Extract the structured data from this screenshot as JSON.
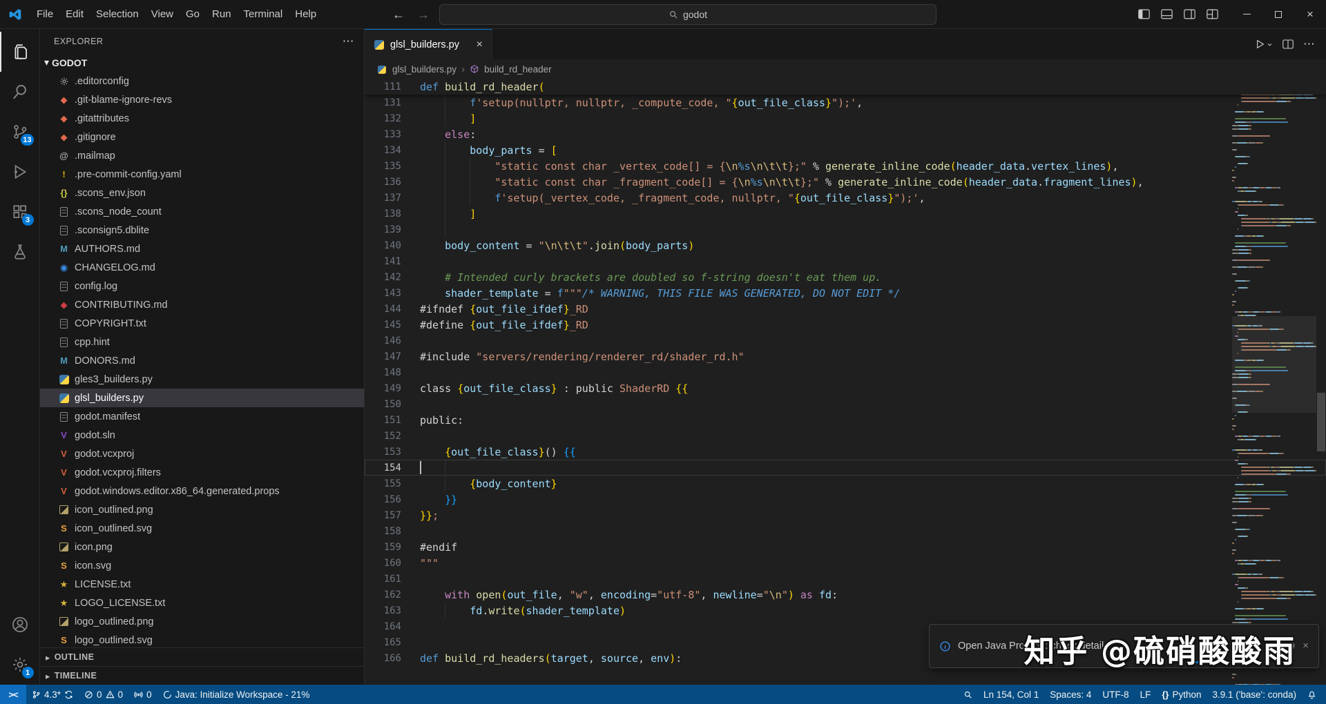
{
  "titlebar": {
    "menus": [
      "File",
      "Edit",
      "Selection",
      "View",
      "Go",
      "Run",
      "Terminal",
      "Help"
    ],
    "back_arrow": "←",
    "forward_arrow": "→",
    "search_value": "godot"
  },
  "activitybar": {
    "items": [
      {
        "name": "explorer",
        "active": true,
        "badge": ""
      },
      {
        "name": "search",
        "active": false,
        "badge": ""
      },
      {
        "name": "source-control",
        "active": false,
        "badge": "13"
      },
      {
        "name": "run-debug",
        "active": false,
        "badge": ""
      },
      {
        "name": "extensions",
        "active": false,
        "badge": "3"
      },
      {
        "name": "testing",
        "active": false,
        "badge": ""
      }
    ],
    "bottom_items": [
      {
        "name": "account",
        "active": false,
        "badge": ""
      },
      {
        "name": "settings",
        "active": false,
        "badge": "1"
      }
    ]
  },
  "sidebar": {
    "title": "EXPLORER",
    "dots": "⋯",
    "section": "GODOT",
    "section_chevron": "▾",
    "outline_label": "OUTLINE",
    "timeline_label": "TIMELINE",
    "panel_chevron": "▸",
    "files": [
      {
        "name": ".editorconfig",
        "icon": "gear",
        "selected": false
      },
      {
        "name": ".git-blame-ignore-revs",
        "icon": "git",
        "selected": false
      },
      {
        "name": ".gitattributes",
        "icon": "git",
        "selected": false
      },
      {
        "name": ".gitignore",
        "icon": "git",
        "selected": false
      },
      {
        "name": ".mailmap",
        "icon": "mail",
        "selected": false
      },
      {
        "name": ".pre-commit-config.yaml",
        "icon": "yaml",
        "selected": false
      },
      {
        "name": ".scons_env.json",
        "icon": "json",
        "selected": false
      },
      {
        "name": ".scons_node_count",
        "icon": "doc",
        "selected": false
      },
      {
        "name": ".sconsign5.dblite",
        "icon": "doc",
        "selected": false
      },
      {
        "name": "AUTHORS.md",
        "icon": "md",
        "selected": false
      },
      {
        "name": "CHANGELOG.md",
        "icon": "changelog",
        "selected": false
      },
      {
        "name": "config.log",
        "icon": "doc",
        "selected": false
      },
      {
        "name": "CONTRIBUTING.md",
        "icon": "contrib",
        "selected": false
      },
      {
        "name": "COPYRIGHT.txt",
        "icon": "doc",
        "selected": false
      },
      {
        "name": "cpp.hint",
        "icon": "doc",
        "selected": false
      },
      {
        "name": "DONORS.md",
        "icon": "md",
        "selected": false
      },
      {
        "name": "gles3_builders.py",
        "icon": "python",
        "selected": false
      },
      {
        "name": "glsl_builders.py",
        "icon": "python",
        "selected": true
      },
      {
        "name": "godot.manifest",
        "icon": "doc",
        "selected": false
      },
      {
        "name": "godot.sln",
        "icon": "sln",
        "selected": false
      },
      {
        "name": "godot.vcxproj",
        "icon": "vs",
        "selected": false
      },
      {
        "name": "godot.vcxproj.filters",
        "icon": "vs",
        "selected": false
      },
      {
        "name": "godot.windows.editor.x86_64.generated.props",
        "icon": "vs",
        "selected": false
      },
      {
        "name": "icon_outlined.png",
        "icon": "image",
        "selected": false
      },
      {
        "name": "icon_outlined.svg",
        "icon": "svgfile",
        "selected": false
      },
      {
        "name": "icon.png",
        "icon": "image",
        "selected": false
      },
      {
        "name": "icon.svg",
        "icon": "svgfile",
        "selected": false
      },
      {
        "name": "LICENSE.txt",
        "icon": "cert",
        "selected": false
      },
      {
        "name": "LOGO_LICENSE.txt",
        "icon": "cert",
        "selected": false
      },
      {
        "name": "logo_outlined.png",
        "icon": "image",
        "selected": false
      },
      {
        "name": "logo_outlined.svg",
        "icon": "svgfile",
        "selected": false
      }
    ]
  },
  "editor": {
    "tab": {
      "label": "glsl_builders.py",
      "close": "×"
    },
    "breadcrumbs": [
      "glsl_builders.py",
      "build_rd_header"
    ],
    "breadcrumb_sep": "›",
    "current_line": 154,
    "cursor_col": 1,
    "sticky": {
      "n": "111",
      "t": [
        [
          "k",
          "def "
        ],
        [
          "fn",
          "build_rd_header"
        ],
        [
          "b1",
          "("
        ]
      ]
    },
    "lines": [
      {
        "n": 131,
        "g": 1,
        "t": [
          [
            "ws",
            "        "
          ],
          [
            "k",
            "f"
          ],
          [
            "s",
            "'setup(nullptr, nullptr, _compute_code, \""
          ],
          [
            "b1",
            "{"
          ],
          [
            "v",
            "out_file_class"
          ],
          [
            "b1",
            "}"
          ],
          [
            "s",
            "\");'"
          ],
          [
            "p",
            ","
          ]
        ]
      },
      {
        "n": 132,
        "g": 1,
        "t": [
          [
            "ws",
            "        "
          ],
          [
            "b1",
            "]"
          ]
        ]
      },
      {
        "n": 133,
        "g": 0,
        "t": [
          [
            "ws",
            "    "
          ],
          [
            "kc",
            "else"
          ],
          [
            "p",
            ":"
          ]
        ]
      },
      {
        "n": 134,
        "g": 1,
        "t": [
          [
            "ws",
            "        "
          ],
          [
            "v",
            "body_parts"
          ],
          [
            "p",
            " = "
          ],
          [
            "b1",
            "["
          ]
        ]
      },
      {
        "n": 135,
        "g": 2,
        "t": [
          [
            "ws",
            "            "
          ],
          [
            "s",
            "\"static const char _vertex_code[] = {"
          ],
          [
            "e",
            "\\n"
          ],
          [
            "fs",
            "%s"
          ],
          [
            "e",
            "\\n\\t\\t"
          ],
          [
            "s",
            "};\""
          ],
          [
            "p",
            " % "
          ],
          [
            "fn",
            "generate_inline_code"
          ],
          [
            "b1",
            "("
          ],
          [
            "v",
            "header_data"
          ],
          [
            "p",
            "."
          ],
          [
            "v",
            "vertex_lines"
          ],
          [
            "b1",
            ")"
          ],
          [
            "p",
            ","
          ]
        ]
      },
      {
        "n": 136,
        "g": 2,
        "t": [
          [
            "ws",
            "            "
          ],
          [
            "s",
            "\"static const char _fragment_code[] = {"
          ],
          [
            "e",
            "\\n"
          ],
          [
            "fs",
            "%s"
          ],
          [
            "e",
            "\\n\\t\\t"
          ],
          [
            "s",
            "};\""
          ],
          [
            "p",
            " % "
          ],
          [
            "fn",
            "generate_inline_code"
          ],
          [
            "b1",
            "("
          ],
          [
            "v",
            "header_data"
          ],
          [
            "p",
            "."
          ],
          [
            "v",
            "fragment_lines"
          ],
          [
            "b1",
            ")"
          ],
          [
            "p",
            ","
          ]
        ]
      },
      {
        "n": 137,
        "g": 2,
        "t": [
          [
            "ws",
            "            "
          ],
          [
            "k",
            "f"
          ],
          [
            "s",
            "'setup(_vertex_code, _fragment_code, nullptr, \""
          ],
          [
            "b1",
            "{"
          ],
          [
            "v",
            "out_file_class"
          ],
          [
            "b1",
            "}"
          ],
          [
            "s",
            "\");'"
          ],
          [
            "p",
            ","
          ]
        ]
      },
      {
        "n": 138,
        "g": 1,
        "t": [
          [
            "ws",
            "        "
          ],
          [
            "b1",
            "]"
          ]
        ]
      },
      {
        "n": 139,
        "g": 1,
        "t": []
      },
      {
        "n": 140,
        "g": 0,
        "t": [
          [
            "ws",
            "    "
          ],
          [
            "v",
            "body_content"
          ],
          [
            "p",
            " = "
          ],
          [
            "s",
            "\""
          ],
          [
            "e",
            "\\n\\t\\t"
          ],
          [
            "s",
            "\""
          ],
          [
            "p",
            "."
          ],
          [
            "fn",
            "join"
          ],
          [
            "b1",
            "("
          ],
          [
            "v",
            "body_parts"
          ],
          [
            "b1",
            ")"
          ]
        ]
      },
      {
        "n": 141,
        "g": 0,
        "t": []
      },
      {
        "n": 142,
        "g": 0,
        "t": [
          [
            "ws",
            "    "
          ],
          [
            "c",
            "# Intended curly brackets are doubled so f-string doesn't eat them up."
          ]
        ]
      },
      {
        "n": 143,
        "g": 0,
        "t": [
          [
            "ws",
            "    "
          ],
          [
            "v",
            "shader_template"
          ],
          [
            "p",
            " = "
          ],
          [
            "k",
            "f"
          ],
          [
            "s",
            "\"\"\""
          ],
          [
            "cm",
            "/* WARNING, THIS FILE WAS GENERATED, DO NOT EDIT */"
          ]
        ]
      },
      {
        "n": 144,
        "g": 0,
        "t": [
          [
            "p",
            "#ifndef "
          ],
          [
            "b1",
            "{"
          ],
          [
            "v",
            "out_file_ifdef"
          ],
          [
            "b1",
            "}"
          ],
          [
            "s",
            "_RD"
          ]
        ]
      },
      {
        "n": 145,
        "g": 0,
        "t": [
          [
            "p",
            "#define "
          ],
          [
            "b1",
            "{"
          ],
          [
            "v",
            "out_file_ifdef"
          ],
          [
            "b1",
            "}"
          ],
          [
            "s",
            "_RD"
          ]
        ]
      },
      {
        "n": 146,
        "g": 0,
        "t": []
      },
      {
        "n": 147,
        "g": 0,
        "t": [
          [
            "p",
            "#include "
          ],
          [
            "s",
            "\"servers/rendering/renderer_rd/shader_rd.h\""
          ]
        ]
      },
      {
        "n": 148,
        "g": 0,
        "t": []
      },
      {
        "n": 149,
        "g": 0,
        "t": [
          [
            "p",
            "class "
          ],
          [
            "b1",
            "{"
          ],
          [
            "v",
            "out_file_class"
          ],
          [
            "b1",
            "}"
          ],
          [
            "p",
            " : public "
          ],
          [
            "s",
            "ShaderRD"
          ],
          [
            "p",
            " "
          ],
          [
            "b1",
            "{{"
          ]
        ]
      },
      {
        "n": 150,
        "g": 0,
        "t": []
      },
      {
        "n": 151,
        "g": 0,
        "t": [
          [
            "p",
            "public:"
          ]
        ]
      },
      {
        "n": 152,
        "g": 0,
        "t": []
      },
      {
        "n": 153,
        "g": 0,
        "t": [
          [
            "ws",
            "    "
          ],
          [
            "b1",
            "{"
          ],
          [
            "v",
            "out_file_class"
          ],
          [
            "b1",
            "}"
          ],
          [
            "p",
            "() "
          ],
          [
            "b2",
            "{{"
          ]
        ]
      },
      {
        "n": 154,
        "g": 1,
        "t": []
      },
      {
        "n": 155,
        "g": 1,
        "t": [
          [
            "ws",
            "        "
          ],
          [
            "b1",
            "{"
          ],
          [
            "v",
            "body_content"
          ],
          [
            "b1",
            "}"
          ]
        ]
      },
      {
        "n": 156,
        "g": 0,
        "t": [
          [
            "ws",
            "    "
          ],
          [
            "b2",
            "}}"
          ]
        ]
      },
      {
        "n": 157,
        "g": 0,
        "t": [
          [
            "b1",
            "}}"
          ],
          [
            "s",
            ";"
          ]
        ]
      },
      {
        "n": 158,
        "g": 0,
        "t": []
      },
      {
        "n": 159,
        "g": 0,
        "t": [
          [
            "p",
            "#endif"
          ]
        ]
      },
      {
        "n": 160,
        "g": 0,
        "t": [
          [
            "s",
            "\"\"\""
          ]
        ]
      },
      {
        "n": 161,
        "g": 0,
        "t": []
      },
      {
        "n": 162,
        "g": 0,
        "t": [
          [
            "ws",
            "    "
          ],
          [
            "kc",
            "with"
          ],
          [
            "p",
            " "
          ],
          [
            "fn",
            "open"
          ],
          [
            "b1",
            "("
          ],
          [
            "v",
            "out_file"
          ],
          [
            "p",
            ", "
          ],
          [
            "s",
            "\"w\""
          ],
          [
            "p",
            ", "
          ],
          [
            "v",
            "encoding"
          ],
          [
            "p",
            "="
          ],
          [
            "s",
            "\"utf-8\""
          ],
          [
            "p",
            ", "
          ],
          [
            "v",
            "newline"
          ],
          [
            "p",
            "="
          ],
          [
            "s",
            "\""
          ],
          [
            "e",
            "\\n"
          ],
          [
            "s",
            "\""
          ],
          [
            "b1",
            ")"
          ],
          [
            "p",
            " "
          ],
          [
            "kc",
            "as"
          ],
          [
            "p",
            " "
          ],
          [
            "v",
            "fd"
          ],
          [
            "p",
            ":"
          ]
        ]
      },
      {
        "n": 163,
        "g": 1,
        "t": [
          [
            "ws",
            "        "
          ],
          [
            "v",
            "fd"
          ],
          [
            "p",
            "."
          ],
          [
            "fn",
            "write"
          ],
          [
            "b1",
            "("
          ],
          [
            "v",
            "shader_template"
          ],
          [
            "b1",
            ")"
          ]
        ]
      },
      {
        "n": 164,
        "g": 0,
        "t": []
      },
      {
        "n": 165,
        "g": 0,
        "t": []
      },
      {
        "n": 166,
        "g": 0,
        "t": [
          [
            "k",
            "def "
          ],
          [
            "fn",
            "build_rd_headers"
          ],
          [
            "b1",
            "("
          ],
          [
            "v",
            "target"
          ],
          [
            "p",
            ", "
          ],
          [
            "v",
            "source"
          ],
          [
            "p",
            ", "
          ],
          [
            "v",
            "env"
          ],
          [
            "b1",
            ")"
          ],
          [
            "p",
            ":"
          ]
        ]
      }
    ]
  },
  "statusbar": {
    "left": [
      {
        "name": "remote-indicator",
        "icon": "remote",
        "label": "><"
      },
      {
        "name": "branch",
        "icon": "branch",
        "label": "4.3*",
        "icon2": "sync"
      },
      {
        "name": "problems",
        "icon": "error",
        "label": "0",
        "icon2": "warning",
        "label2": "0"
      },
      {
        "name": "ports",
        "icon": "broadcast",
        "label": "0"
      },
      {
        "name": "java-status",
        "icon": "loading",
        "label": "Java: Initialize Workspace - 21%"
      }
    ],
    "right": [
      {
        "name": "search-status",
        "icon": "search",
        "label": ""
      },
      {
        "name": "cursor-position",
        "icon": "",
        "label": "Ln 154, Col 1"
      },
      {
        "name": "indentation",
        "icon": "",
        "label": "Spaces: 4"
      },
      {
        "name": "encoding",
        "icon": "",
        "label": "UTF-8"
      },
      {
        "name": "eol",
        "icon": "",
        "label": "LF"
      },
      {
        "name": "language-mode",
        "icon": "braces",
        "label": "Python"
      },
      {
        "name": "python-interpreter",
        "icon": "",
        "label": "3.9.1 ('base': conda)"
      },
      {
        "name": "notifications-bell",
        "icon": "bell",
        "label": ""
      }
    ]
  },
  "notification": {
    "info_icon": "info",
    "text": "Open Java Projects: check details",
    "gear": "⚙",
    "close": "×"
  },
  "watermark": "知乎 @硫硝酸酸雨",
  "colors": {
    "accent": "#0078d4",
    "statusbar_bg": "#064c82",
    "remote_bg": "#0f6cbd",
    "editor_bg": "#1f1f1f",
    "sidebar_bg": "#181818",
    "selection_bg": "#37373d",
    "badge_bg": "#0078d4"
  }
}
